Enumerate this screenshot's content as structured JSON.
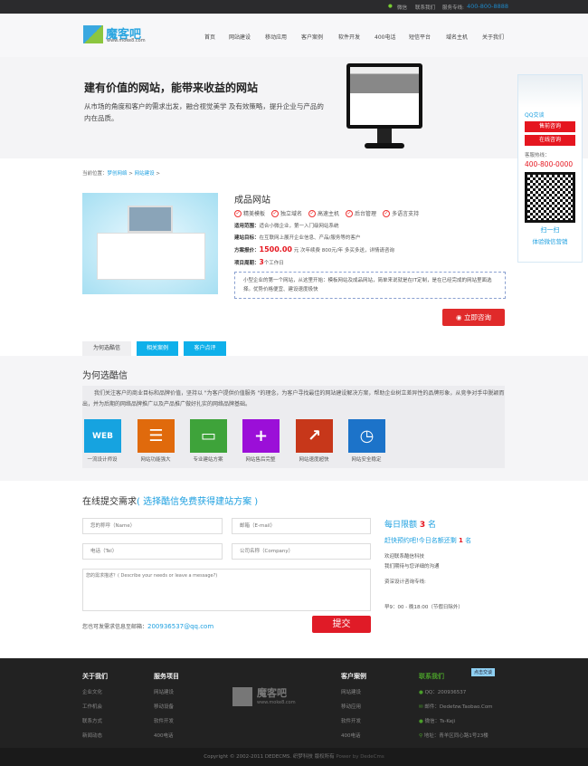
{
  "topbar": {
    "wechat": "微信",
    "contact": "联系我们",
    "hotline_label": "服务专线:",
    "hotline": "400-800-8888"
  },
  "logo": {
    "name": "魔客吧",
    "url": "www.moke8.com"
  },
  "nav": [
    "首页",
    "网站建设",
    "移动应用",
    "客户案例",
    "软件开发",
    "400电话",
    "短信平台",
    "域名主机",
    "关于我们"
  ],
  "hero": {
    "title": "建有价值的网站，能带来收益的网站",
    "desc": "从市场的角度和客户的需求出发，融合视觉美学 及有效策略，提升企业与产品的内在品质。"
  },
  "breadcrumb": {
    "label": "当前位置：",
    "items": [
      "梦创网络",
      "网站建设"
    ],
    "sep": ">"
  },
  "product": {
    "title": "成品网站",
    "features": [
      "精美模板",
      "独立域名",
      "高速主机",
      "后台管理",
      "多语言支持"
    ],
    "scope_label": "适用范围：",
    "scope": "适合小微企业，第一入门级网站系统",
    "goal_label": "建站目标：",
    "goal": "在互联网上展开企业信息、产品/服务等的客户",
    "price_label": "方案报价：",
    "price": "1500.00",
    "price_unit": "元",
    "price_note": "次年续费 800元/年 多买多送，详情请咨询",
    "period_label": "项目周期：",
    "period": "3",
    "period_unit": "个工作日",
    "desc": "小型企业的第一个网站，从这里开始：模板网站及成品网站，简单来说就是在IT定制，是在已经完成的网站里面选择。优势价格便宜、建设速度极快",
    "consult": "立即咨询"
  },
  "tabs": [
    "为何选酷信",
    "相关案例",
    "客户点评"
  ],
  "why": {
    "title": "为何选酷信",
    "text": "我们关注客户的商业目标和品牌价值，坚持以 \"为客户提供价值服务 \"的理念，为客户寻找最佳的网站建设解决方案，帮助企业树立差异性的品牌形象，从竞争对手中脱颖而出，并为后期的网络品牌推广以及产品推广做好扎实的网络品牌基础。",
    "items": [
      {
        "label": "一流设计师设",
        "icon": "web-icon",
        "color": "#16a3e0"
      },
      {
        "label": "网站功能强大",
        "icon": "list-icon",
        "color": "#e06a0c"
      },
      {
        "label": "专业建站方案",
        "icon": "cards-icon",
        "color": "#3ea33a"
      },
      {
        "label": "网站售后完整",
        "icon": "plus-icon",
        "color": "#9b0fd8"
      },
      {
        "label": "网站速度超快",
        "icon": "chart-icon",
        "color": "#c7371a"
      },
      {
        "label": "网站安全稳定",
        "icon": "clock-icon",
        "color": "#1c73c9"
      }
    ]
  },
  "form": {
    "title": "在线提交需求",
    "subtitle": "( 选择酷信免费获得建站方案 )",
    "name_ph": "您的称呼（Name）",
    "email_ph": "邮箱（E-mail）",
    "tel_ph": "电话（Tel）",
    "company_ph": "公司名称（Company）",
    "msg_ph": "您的需求描述？( Describe your needs or leave a message?)",
    "note": "您也可发需求信息至邮箱：",
    "email": "200936537@qq.com",
    "submit": "提交"
  },
  "quota": {
    "l1a": "每日限额",
    "n1": "3",
    "l1b": "名",
    "l2a": "赶快预约吧!今日名额还剩",
    "n2": "1",
    "l2b": "名",
    "w1": "欢迎联系酷信科技",
    "w2": "我们期待与您详细的沟通",
    "hotline": "资深设计咨询专线:",
    "hours": "早9：00 - 晚18:00（节假日除外）"
  },
  "float": {
    "qq": "QQ交谈",
    "presale": "售前咨询",
    "online": "在线咨询",
    "hotline_label": "客服热线：",
    "hotline": "400-800-0000",
    "scan": "扫一扫",
    "wechat": "体验微信营销"
  },
  "footer": {
    "about": {
      "title": "关于我们",
      "items": [
        "企业文化",
        "工作机会",
        "联系方式",
        "新闻动态"
      ]
    },
    "service": {
      "title": "服务项目",
      "items": [
        "网站建设",
        "移动设备",
        "软件开发",
        "400电话"
      ]
    },
    "cases": {
      "title": "客户案例",
      "items": [
        "网站建设",
        "移动应用",
        "软件开发",
        "400电话"
      ]
    },
    "contact": {
      "title": "联系我们",
      "chat": "点击交谈",
      "qq": "QQ：200936537",
      "mail": "邮件：Dedefzw.Taobao.Com",
      "wechat": "微信：Ts-Keji",
      "addr": "地址：青羊区同心路1号23楼"
    },
    "copyright": "Copyright © 2002-2011 DEDECMS. 织梦科技 版权所有",
    "power": "Power by DedeCms"
  }
}
